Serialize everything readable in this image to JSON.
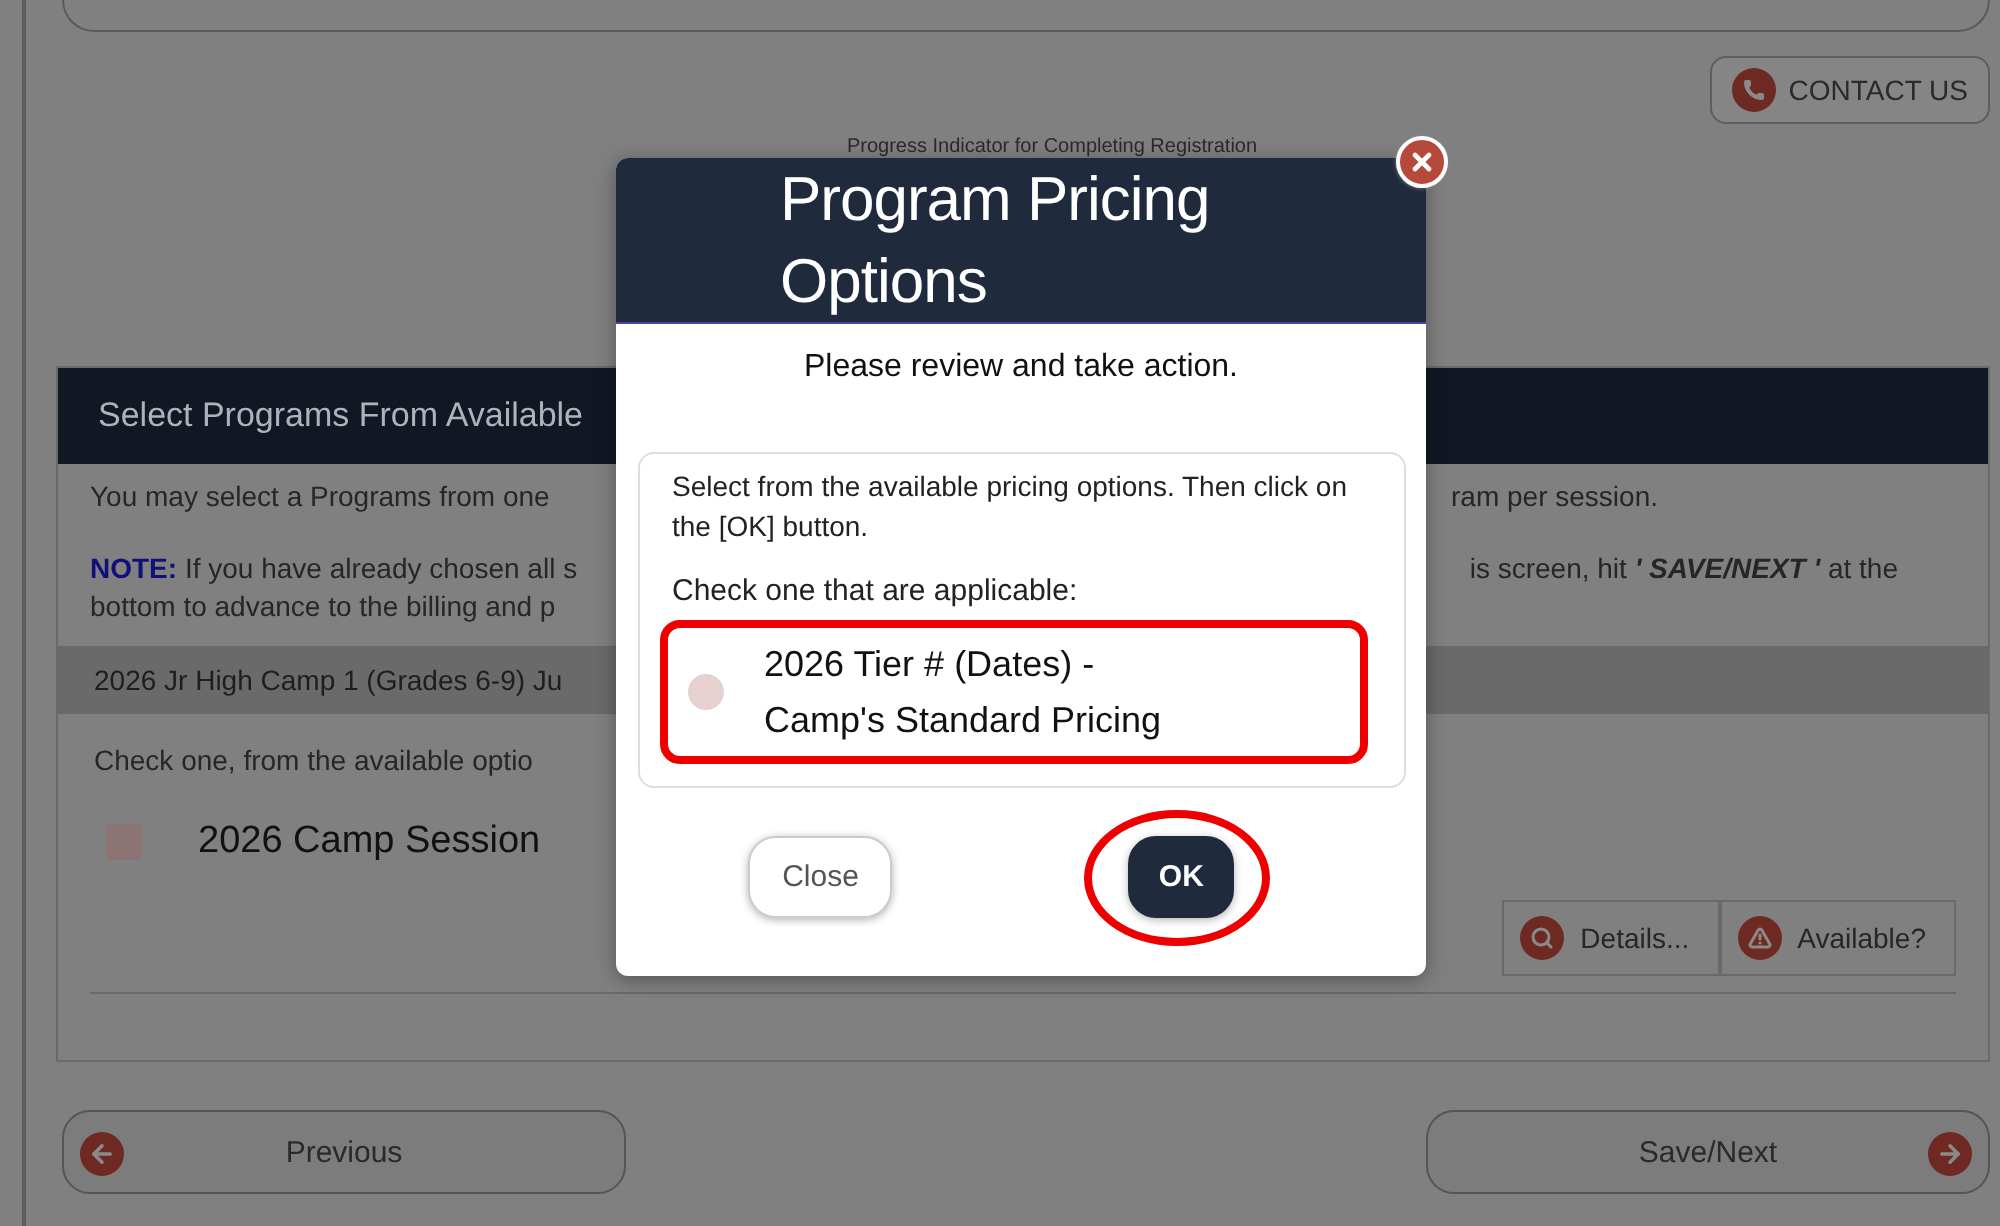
{
  "page": {
    "contact_button": "CONTACT US",
    "progress_caption": "Progress Indicator for Completing Registration"
  },
  "section": {
    "title": "Select Programs From Available",
    "intro_left": "You may select a Programs from one",
    "intro_right": "ram per session.",
    "note_left": "**NOTE:** If you have already chosen all s",
    "note_right": "is screen, hit **' SAVE/NEXT '** at the",
    "note_line2": "bottom to advance to the billing and p",
    "row_title": "2026 Jr High Camp 1 (Grades 6-9) Ju",
    "check_prompt": "Check one, from the available optio",
    "sessions": [
      {
        "label": "2026 Camp Session",
        "checked": false
      }
    ],
    "actions": [
      {
        "kind": "details",
        "label": "Details..."
      },
      {
        "kind": "availability",
        "label": "Available?"
      }
    ]
  },
  "nav": {
    "previous": "Previous",
    "next": "Save/Next"
  },
  "modal": {
    "title": "Program Pricing Options",
    "subtitle": "Please review and take action.",
    "instructions": "Select from the available pricing options. Then click on the [OK] button.",
    "prompt": "Check one that are applicable:",
    "options": [
      {
        "lines": [
          "2026 Tier # (Dates) -",
          "Camp's Standard Pricing"
        ],
        "selected": false,
        "highlighted": true
      }
    ],
    "buttons": [
      {
        "kind": "secondary",
        "label": "Close",
        "highlighted": false
      },
      {
        "kind": "primary",
        "label": "OK",
        "highlighted": true
      }
    ]
  }
}
